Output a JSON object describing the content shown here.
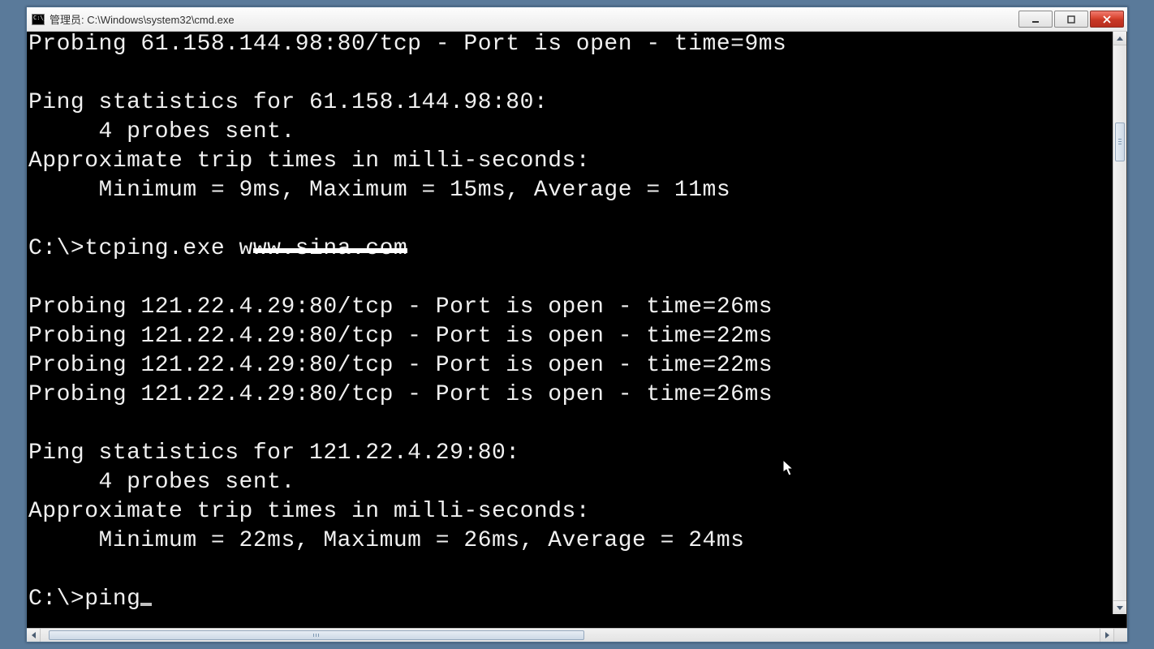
{
  "window": {
    "title": "管理员: C:\\Windows\\system32\\cmd.exe"
  },
  "terminal": {
    "lines": [
      "Probing 61.158.144.98:80/tcp - Port is open - time=9ms",
      "",
      "Ping statistics for 61.158.144.98:80:",
      "     4 probes sent.",
      "Approximate trip times in milli-seconds:",
      "     Minimum = 9ms, Maximum = 15ms, Average = 11ms",
      "",
      "C:\\>tcping.exe www.sina.com",
      "",
      "Probing 121.22.4.29:80/tcp - Port is open - time=26ms",
      "Probing 121.22.4.29:80/tcp - Port is open - time=22ms",
      "Probing 121.22.4.29:80/tcp - Port is open - time=22ms",
      "Probing 121.22.4.29:80/tcp - Port is open - time=26ms",
      "",
      "Ping statistics for 121.22.4.29:80:",
      "     4 probes sent.",
      "Approximate trip times in milli-seconds:",
      "     Minimum = 22ms, Maximum = 26ms, Average = 24ms",
      "",
      "C:\\>ping"
    ],
    "redaction": {
      "line_index": 7,
      "col_start": 16,
      "col_end": 28
    },
    "prompt_has_cursor": true
  }
}
